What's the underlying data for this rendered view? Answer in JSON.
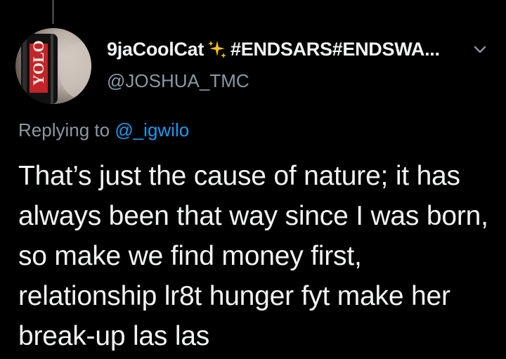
{
  "tweet": {
    "author": {
      "display_name": "9jaCoolCat",
      "display_tags": "#ENDSARS#ENDSWA...",
      "handle": "@JOSHUA_TMC",
      "avatar_caption": "YOLO",
      "sparkle_icon": "sparkles-icon",
      "menu_icon": "chevron-down-icon"
    },
    "reply": {
      "prefix": "Replying to",
      "mention": "@_igwilo"
    },
    "text": "That’s just the cause of nature; it has always been that way since I was born, so make we find money first, relationship lr8t hunger fyt make her break-up las las"
  },
  "colors": {
    "background": "#000000",
    "text": "#f2f3f4",
    "secondary": "#8b98a5",
    "link": "#1d9bf0",
    "sparkle": "#f5c518"
  }
}
